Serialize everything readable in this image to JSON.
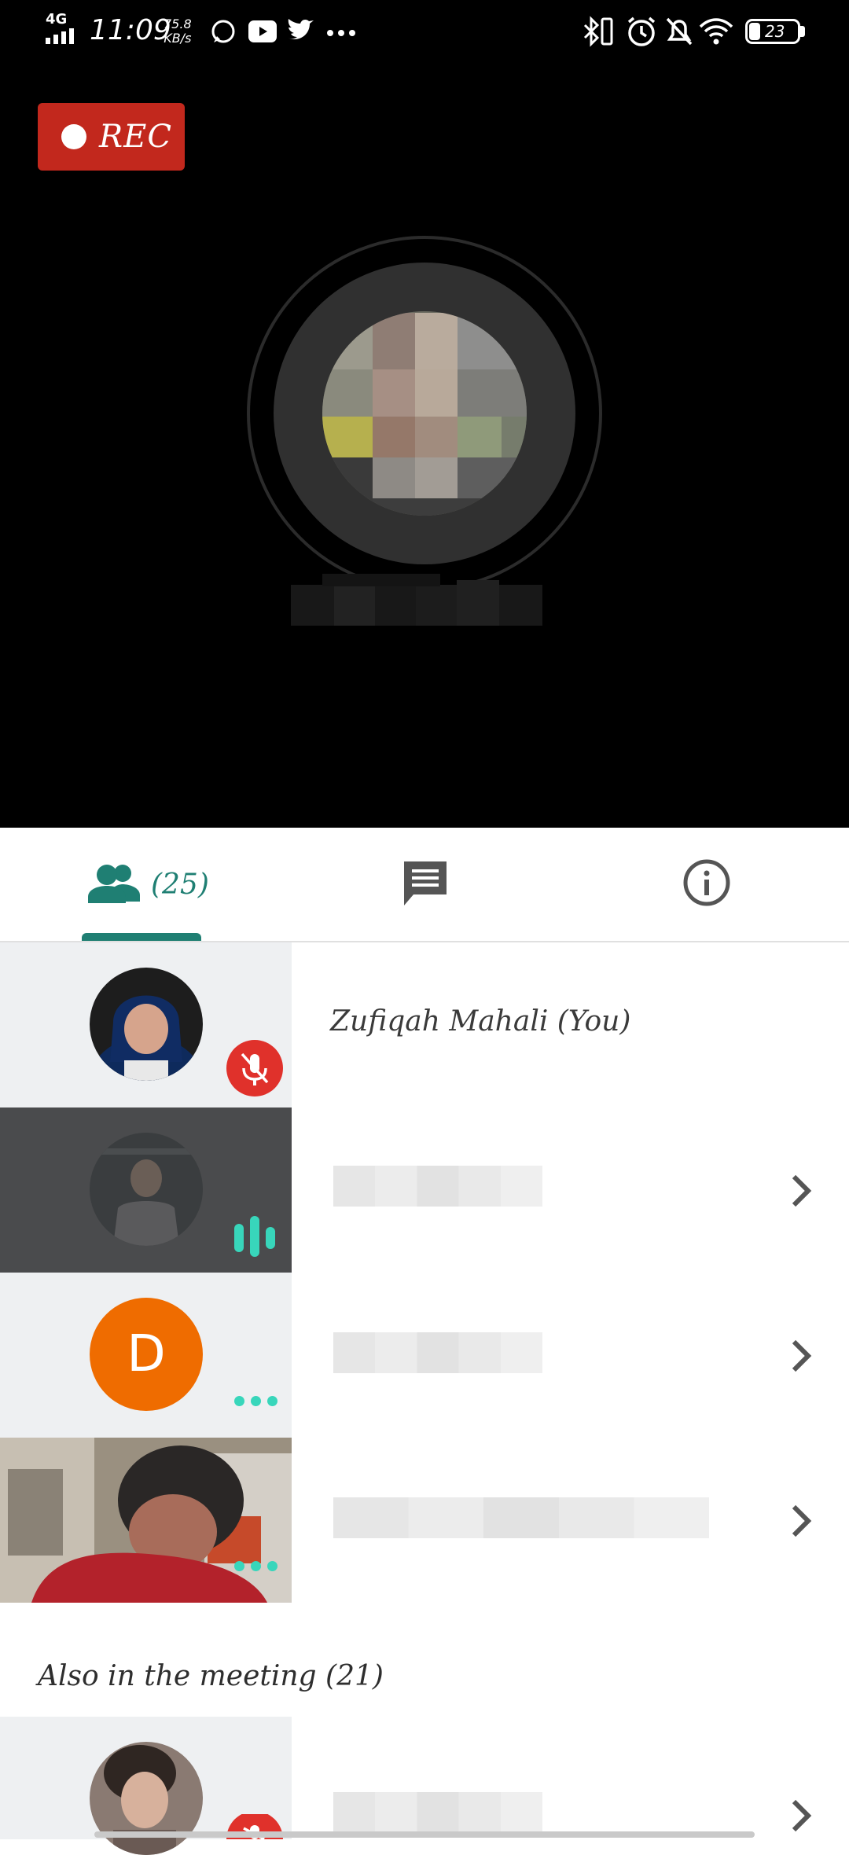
{
  "status_bar": {
    "network": "4G",
    "time": "11:09",
    "speed_value": "75.8",
    "speed_unit": "KB/s",
    "battery": "23"
  },
  "recording": {
    "label": "REC"
  },
  "tabs": {
    "participant_count": "(25)"
  },
  "participants": [
    {
      "name": "Zufiqah Mahali (You)",
      "mic": "muted"
    },
    {
      "status": "speaking"
    },
    {
      "avatar_letter": "D",
      "status": "connecting"
    },
    {
      "status": "connecting"
    }
  ],
  "also_in_meeting": {
    "title": "Also in the meeting (21)"
  },
  "colors": {
    "accent": "#1f7f73",
    "rec_red": "#c2281d",
    "mute_red": "#e0312b",
    "avatar_orange": "#ef6c00",
    "speaking_green": "#38d6bb"
  },
  "icons": [
    "people-icon",
    "chat-icon",
    "info-icon",
    "mic-off-icon",
    "chevron-right-icon"
  ]
}
